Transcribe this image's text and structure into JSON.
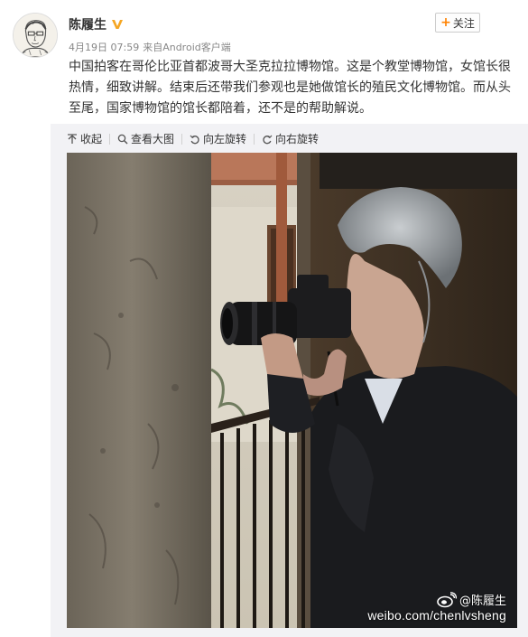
{
  "post": {
    "author": {
      "name": "陈履生",
      "avatar_icon": "avatar-portrait-sketch",
      "verified_icon": "verified-v-badge",
      "verified_color": "#f5a623"
    },
    "meta": {
      "date": "4月19日 07:59",
      "source_prefix": "来自",
      "source_app": "Android客户端"
    },
    "follow_button": {
      "plus": "+",
      "label": "关注",
      "accent": "#ff8200"
    },
    "text": "中国拍客在哥伦比亚首都波哥大圣克拉拉博物馆。这是个教堂博物馆，女馆长很热情，细致讲解。结束后还带我们参观也是她做馆长的殖民文化博物馆。而从头至尾，国家博物馆的馆长都陪着，还不是的帮助解说。"
  },
  "media": {
    "toolbar": [
      {
        "icon": "collapse-up-icon",
        "label": "收起"
      },
      {
        "icon": "zoom-search-icon",
        "label": "查看大图"
      },
      {
        "icon": "rotate-left-icon",
        "label": "向左旋转"
      },
      {
        "icon": "rotate-right-icon",
        "label": "向右旋转"
      }
    ],
    "photo": {
      "watermark_handle": "@陈履生",
      "watermark_url": "weibo.com/chenlvsheng",
      "watermark_logo": "weibo-logo"
    }
  },
  "colors": {
    "text": "#333333",
    "meta": "#888888",
    "panel_bg": "#f2f2f5"
  }
}
